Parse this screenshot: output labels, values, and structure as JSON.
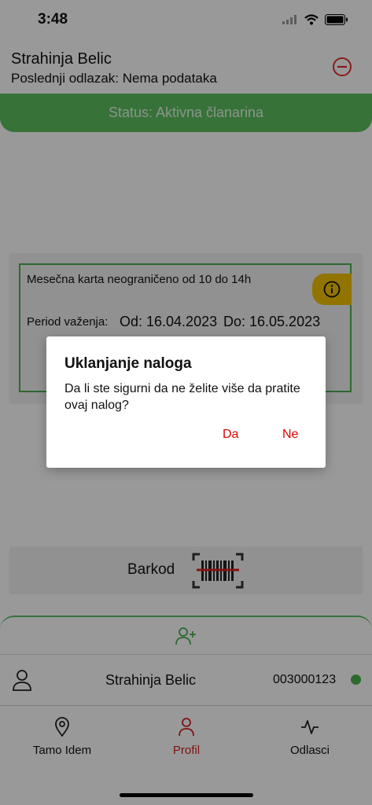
{
  "status_bar": {
    "time": "3:48"
  },
  "header": {
    "user_name": "Strahinja Belic",
    "last_visit": "Poslednji odlazak: Nema podataka",
    "remove_icon": "minus-circle-icon"
  },
  "membership_status": "Status: Aktivna članarina",
  "card": {
    "title": "Mesečna karta neograničeno od 10 do 14h",
    "period_label": "Period važenja:",
    "from": "Od: 16.04.2023",
    "to": "Do: 16.05.2023",
    "info_icon": "info-icon"
  },
  "barcode": {
    "label": "Barkod",
    "icon": "barcode-icon"
  },
  "account": {
    "name": "Strahinja Belic",
    "number": "003000123",
    "add_icon": "add-user-icon"
  },
  "tabs": [
    {
      "label": "Tamo Idem",
      "icon": "location-pin-icon",
      "active": false
    },
    {
      "label": "Profil",
      "icon": "person-icon",
      "active": true
    },
    {
      "label": "Odlasci",
      "icon": "activity-icon",
      "active": false
    }
  ],
  "dialog": {
    "title": "Uklanjanje naloga",
    "message": "Da li ste sigurni da ne želite više da pratite ovaj nalog?",
    "yes": "Da",
    "no": "Ne"
  },
  "colors": {
    "accent_green": "#5cbf60",
    "warning_yellow": "#f2c200",
    "danger_red": "#e00000"
  }
}
